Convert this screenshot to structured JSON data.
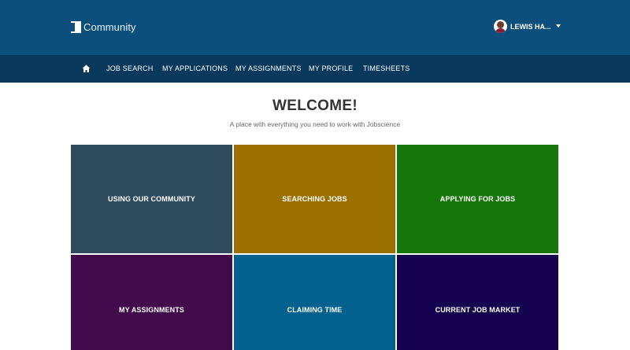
{
  "header": {
    "logo_text": "Community",
    "user_name": "LEWIS HA..."
  },
  "nav": {
    "items": [
      {
        "label": "JOB SEARCH"
      },
      {
        "label": "MY APPLICATIONS"
      },
      {
        "label": "MY ASSIGNMENTS"
      },
      {
        "label": "MY PROFILE"
      },
      {
        "label": "TIMESHEETS"
      }
    ]
  },
  "main": {
    "title": "WELCOME!",
    "subtitle": "A place with everything you need to work with Jobscience"
  },
  "tiles": [
    {
      "label": "USING OUR COMMUNITY",
      "color": "#2e4a5d"
    },
    {
      "label": "SEARCHING JOBS",
      "color": "#9c7000"
    },
    {
      "label": "APPLYING FOR JOBS",
      "color": "#17760a"
    },
    {
      "label": "MY ASSIGNMENTS",
      "color": "#420b4b"
    },
    {
      "label": "CLAIMING TIME",
      "color": "#03618f"
    },
    {
      "label": "CURRENT JOB MARKET",
      "color": "#150350"
    }
  ]
}
